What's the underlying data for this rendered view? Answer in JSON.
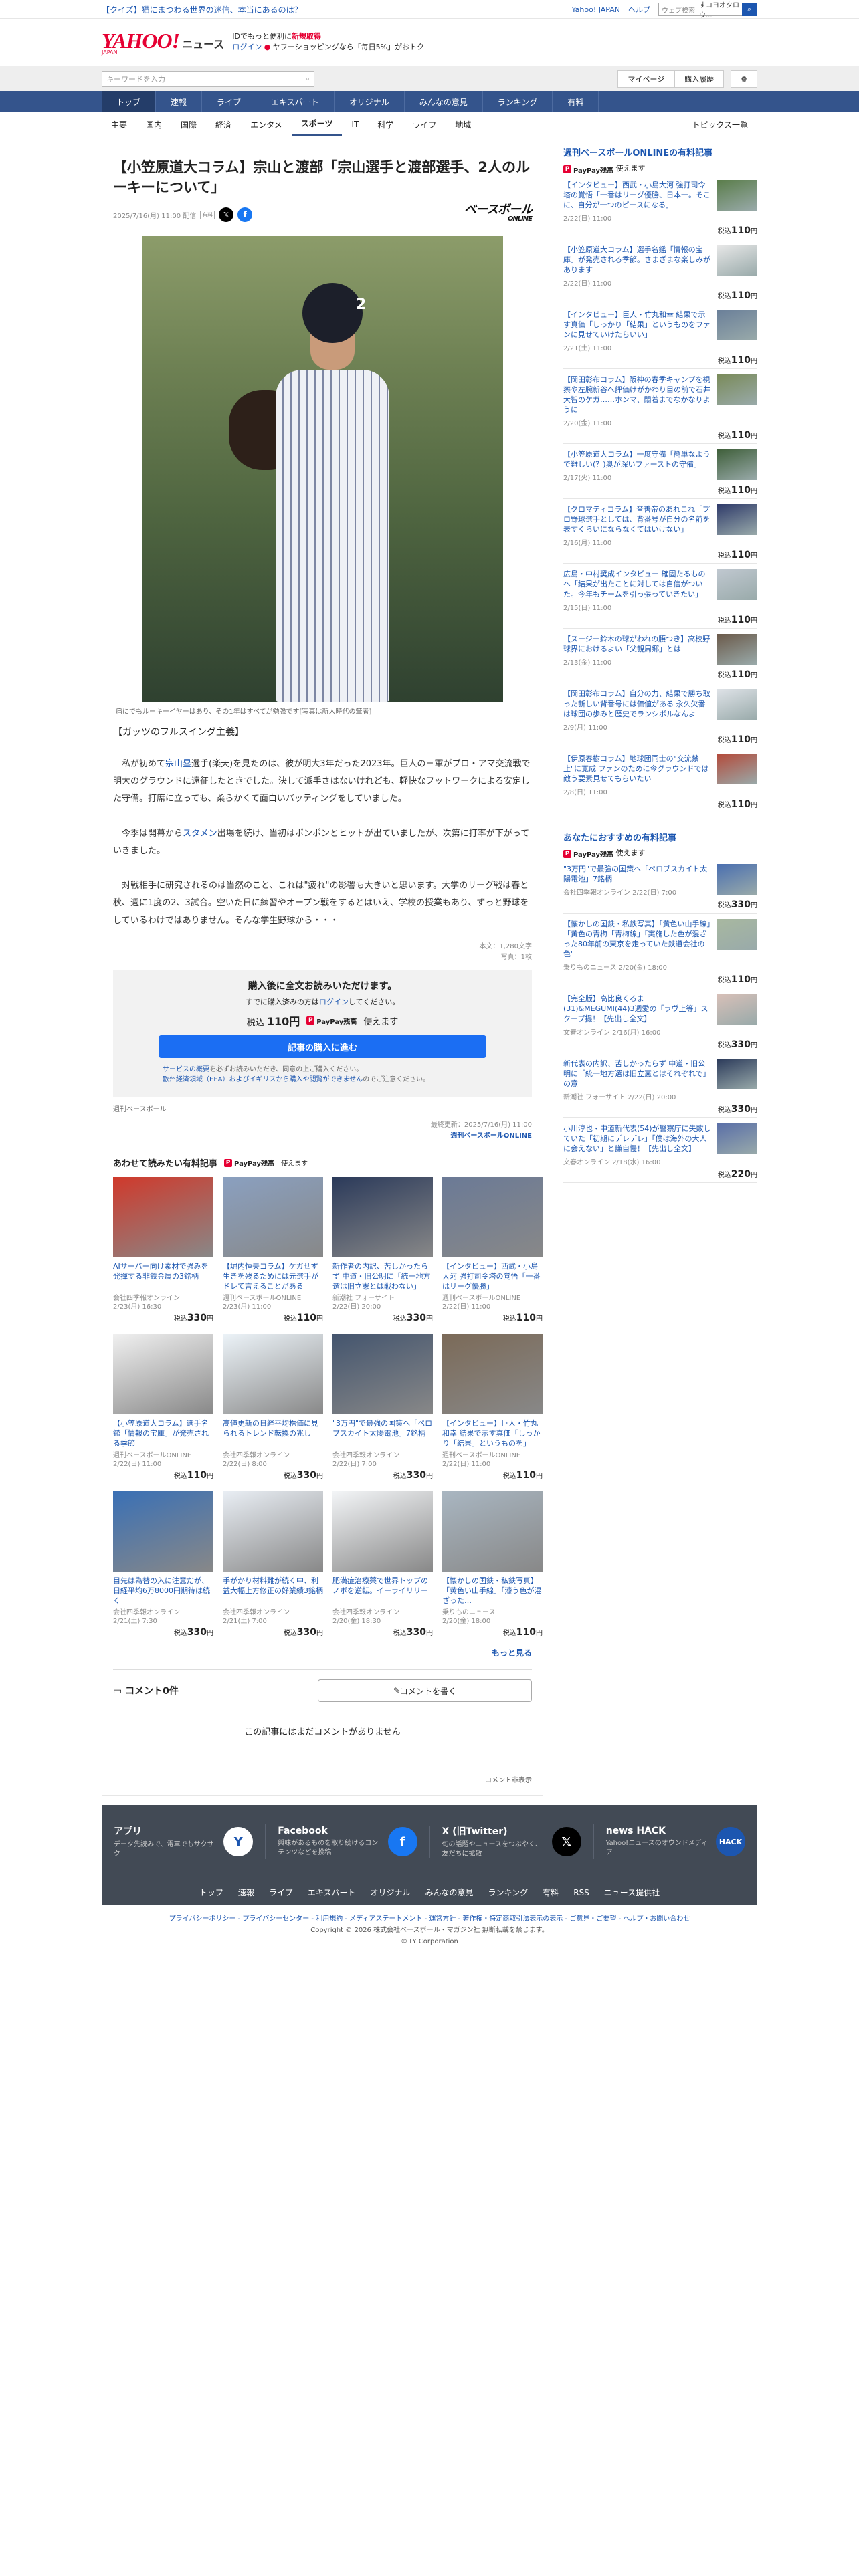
{
  "topbar": {
    "promo": "【クイズ】猫にまつわる世界の迷信、本当にあるのは？",
    "links": [
      "Yahoo! JAPAN",
      "ヘルプ"
    ],
    "web_search_placeholder": "ウェブ検索",
    "web_search_value": "すコヨオタロウ..."
  },
  "header": {
    "logo": "YAHOO!",
    "logo_sub": "JAPAN",
    "service": "ニュース",
    "msg1": "IDでもっと便利に",
    "msg1_link": "新規取得",
    "msg2_login": "ログイン",
    "msg2_rest": " ヤフーショッピングなら「毎日5%」がおトク"
  },
  "search": {
    "placeholder": "キーワードを入力",
    "mypage": "マイページ",
    "history": "購入履歴"
  },
  "gnav": [
    "トップ",
    "速報",
    "ライブ",
    "エキスパート",
    "オリジナル",
    "みんなの意見",
    "ランキング",
    "有料"
  ],
  "snav": [
    "主要",
    "国内",
    "国際",
    "経済",
    "エンタメ",
    "スポーツ",
    "IT",
    "科学",
    "ライフ",
    "地域"
  ],
  "snav_right": "トピックス一覧",
  "article": {
    "title": "【小笠原道大コラム】宗山と渡部「宗山選手と渡部選手、2人のルーキーについて」",
    "date": "2025/7/16(月) 11:00 配信",
    "badge": "有料",
    "publisher_logo": "ベースボール",
    "publisher_logo_sub": "ONLINE",
    "jersey": "2",
    "caption": "肩にでもルーキーイヤーはあり、その1年はすべてが勉強です[写真は新人時代の筆者]",
    "subhead": "【ガッツのフルスイング主義】",
    "p1_a": "私が初めて",
    "p1_link": "宗山塁",
    "p1_b": "選手(楽天)を見たのは、彼が明大3年だった2023年。巨人の三軍がプロ・アマ交流戦で明大のグラウンドに遠征したときでした。決して派手さはないけれども、軽快なフットワークによる安定した守備。打席に立っても、柔らかくて面白いバッティングをしていました。",
    "p2_a": "今季は開幕から",
    "p2_link": "スタメン",
    "p2_b": "出場を続け、当初はポンポンとヒットが出ていましたが、次第に打率が下がっていきました。",
    "p3": "対戦相手に研究されるのは当然のこと、これは\"疲れ\"の影響も大きいと思います。大学のリーグ戦は春と秋、週に1度の2、3試合。空いた日に練習やオープン戦をするとはいえ、学校の授業もあり、ずっと野球をしているわけではありません。そんな学生野球から・・・",
    "chars": "本文：1,280文字",
    "photos": "写真：1枚",
    "buy_title": "購入後に全文お読みいただけます。",
    "buy_login_a": "すでに購入済みの方は",
    "buy_login_link": "ログイン",
    "buy_login_b": "してください。",
    "price_label": "税込",
    "price": "110円",
    "paypay": "PayPay残高",
    "paypay_use": "使えます",
    "buy_btn": "記事の購入に進む",
    "note_a": "サービスの概要",
    "note_b": "を必ずお読みいただき、同意の上ご購入ください。",
    "note_c": "欧州経済領域（EEA）およびイギリスから購入や閲覧ができません",
    "note_d": "のでご注意ください。",
    "source": "週刊ベースボール",
    "updated": "最終更新：2025/7/16(月) 11:00",
    "updated_src": "週刊ベースボールONLINE"
  },
  "related": {
    "title": "あわせて読みたい有料記事",
    "paypay": "PayPay残高",
    "paypay_use": "使えます",
    "more": "もっと見る",
    "cards": [
      {
        "t": "AIサーバー向け素材で強みを発揮する非鉄金属の3銘柄",
        "s": "会社四季報オンライン",
        "d": "2/23(月) 16:30",
        "p": "330"
      },
      {
        "t": "【堀内恒夫コラム】ケガせず生きを残るためには元選手がドレて言えることがある",
        "s": "週刊ベースボールONLINE",
        "d": "2/23(月) 11:00",
        "p": "110"
      },
      {
        "t": "新作者の内訳、苦しかったらず 中道・旧公明に「統一地方選は旧立憲とは戦わない」",
        "s": "新潮社 フォーサイト",
        "d": "2/22(日) 20:00",
        "p": "330"
      },
      {
        "t": "【インタビュー】西武・小島大河 強打司令塔の覚悟「一番はリーグ優勝」",
        "s": "週刊ベースボールONLINE",
        "d": "2/22(日) 11:00",
        "p": "110"
      },
      {
        "t": "【小笠原道大コラム】選手名鑑「情報の宝庫」が発売される季節",
        "s": "週刊ベースボールONLINE",
        "d": "2/22(日) 11:00",
        "p": "110"
      },
      {
        "t": "高値更新の日経平均株価に見られるトレンド転換の兆し",
        "s": "会社四季報オンライン",
        "d": "2/22(日) 8:00",
        "p": "330"
      },
      {
        "t": "\"3万円\"で最強の国策へ「ペロブスカイト太陽電池」7銘柄",
        "s": "会社四季報オンライン",
        "d": "2/22(日) 7:00",
        "p": "330"
      },
      {
        "t": "【インタビュー】巨人・竹丸和幸 結果で示す真価「しっかり「結果」というものを」",
        "s": "週刊ベースボールONLINE",
        "d": "2/22(日) 11:00",
        "p": "110"
      },
      {
        "t": "目先は為替の入に注意だが、日経平均6万8000円期待は続く",
        "s": "会社四季報オンライン",
        "d": "2/21(土) 7:30",
        "p": "330"
      },
      {
        "t": "手がかり材料難が続く中、利益大幅上方修正の好業績3銘柄",
        "s": "会社四季報オンライン",
        "d": "2/21(土) 7:00",
        "p": "330"
      },
      {
        "t": "肥満症治療薬で世界トップのノボを逆転。イーライリリー",
        "s": "会社四季報オンライン",
        "d": "2/20(金) 18:30",
        "p": "330"
      },
      {
        "t": "【懐かしの国鉄・私鉄写真】「黄色い山手線」「漆う色が混ざった…",
        "s": "乗りものニュース",
        "d": "2/20(金) 18:00",
        "p": "110"
      }
    ]
  },
  "comments": {
    "count": "コメント0件",
    "write": "コメントを書く",
    "empty": "この記事にはまだコメントがありません",
    "hide": "コメント非表示"
  },
  "side1": {
    "title": "週刊ベースボールONLINEの有料記事",
    "paypay": "PayPay残高",
    "paypay_use": "使えます",
    "items": [
      {
        "t": "【インタビュー】西武・小島大河 強打司令塔の覚悟「一番はリーグ優勝、日本一。そこに、自分が一つのピースになる」",
        "d": "2/22(日) 11:00",
        "p": "110"
      },
      {
        "t": "【小笠原道大コラム】選手名鑑「情報の宝庫」が発売される季節。さまざまな楽しみがあります",
        "d": "2/22(日) 11:00",
        "p": "110"
      },
      {
        "t": "【インタビュー】巨人・竹丸和幸 結果で示す真価「しっかり「結果」というものをファンに見せていけたらいい」",
        "d": "2/21(土) 11:00",
        "p": "110"
      },
      {
        "t": "【岡田彰布コラム】阪神の春季キャンプを視察や左腕新谷へ評価けがかわり目の前で石井大智のケガ……ホンマ、悶着までなかなりように",
        "d": "2/20(金) 11:00",
        "p": "110"
      },
      {
        "t": "【小笠原道大コラム】一度守備「簡単なようで難しい(？)奥が深いファーストの守備」",
        "d": "2/17(火) 11:00",
        "p": "110"
      },
      {
        "t": "【クロマティコラム】音善帝のあれこれ「プロ野球選手としては、背番号が自分の名前を表すくらいにならなくてはいけない」",
        "d": "2/16(月) 11:00",
        "p": "110"
      },
      {
        "t": "広島・中村奨成インタビュー 確固たるものへ「結果が出たことに対しては自信がついた。今年もチームを引っ張っていきたい」",
        "d": "2/15(日) 11:00",
        "p": "110"
      },
      {
        "t": "【スージー鈴木の球がわれの腰つき】高校野球界におけるよい「父親周郷」とは",
        "d": "2/13(金) 11:00",
        "p": "110"
      },
      {
        "t": "【岡田彰布コラム】自分の力、結果で勝ち取った新しい背番号には価値がある 永久欠番は球団の歩みと歴史でランシボルなんよ",
        "d": "2/9(月) 11:00",
        "p": "110"
      },
      {
        "t": "【伊原春樹コラム】地球団同士の\"交流禁止\"に寛成 ファンのために今グラウンドでは敵う要素見せてもらいたい",
        "d": "2/8(日) 11:00",
        "p": "110"
      }
    ]
  },
  "side2": {
    "title": "あなたにおすすめの有料記事",
    "paypay": "PayPay残高",
    "paypay_use": "使えます",
    "items": [
      {
        "t": "\"3万円\"で最強の国策へ「ペロブスカイト太陽電池」7銘柄",
        "d": "会社四季報オンライン 2/22(日) 7:00",
        "p": "330"
      },
      {
        "t": "【懐かしの国鉄・私鉄写真】「黄色い山手線」「黄色の青梅「青梅線」「実施した色が混ざった80年前の東京を走っていた鉄道会社の色\"",
        "d": "乗りものニュース 2/20(金) 18:00",
        "p": "110"
      },
      {
        "t": "【完全版】高比良くるま(31)&MEGUMI(44)3週愛の「ラヴ上等」スクープ撮！【先出し全文】",
        "d": "文春オンライン 2/16(月) 16:00",
        "p": "330"
      },
      {
        "t": "新代表の内訳、苦しかったらず 中道・旧公明に「統一地方選は旧立憲とはそれぞれで」の意",
        "d": "新潮社 フォーサイト 2/22(日) 20:00",
        "p": "330"
      },
      {
        "t": "小川淳也・中道新代表(54)が警察庁に失敗していた「初期にデレデレ」「僕は海外の大人に会えない」と謙自慢！【先出し全文】",
        "d": "文春オンライン 2/18(水) 16:00",
        "p": "220"
      }
    ]
  },
  "footer": {
    "apps": [
      {
        "n": "アプリ",
        "d": "データ先読みで、電車でもサクサク",
        "i": "Y"
      },
      {
        "n": "Facebook",
        "d": "興味があるものを取り続けるコンテンツなどを投稿",
        "i": "f"
      },
      {
        "n": "X (旧Twitter)",
        "d": "旬の話題やニュースをつぶやく、友だちに拡散",
        "i": "𝕏"
      },
      {
        "n": "news HACK",
        "d": "Yahoo!ニュースのオウンドメディア",
        "i": "HACK"
      }
    ],
    "links": [
      "トップ",
      "速報",
      "ライブ",
      "エキスパート",
      "オリジナル",
      "みんなの意見",
      "ランキング",
      "有料",
      "RSS",
      "ニュース提供社"
    ],
    "legal1": "プライバシーポリシー - プライバシーセンター - 利用規約 - メディアステートメント - 運営方針 - 著作権・特定商取引法表示の表示 - ご意見・ご要望 - ヘルプ・お問い合わせ",
    "legal2": "Copyright © 2026 株式会社ベースボール・マガジン社 無断転載を禁じます。",
    "legal3": "© LY Corporation"
  },
  "colors": {
    "nav": "#34548c",
    "link": "#1c56b0",
    "accent": "#e60033",
    "buy": "#1b6ef3"
  }
}
